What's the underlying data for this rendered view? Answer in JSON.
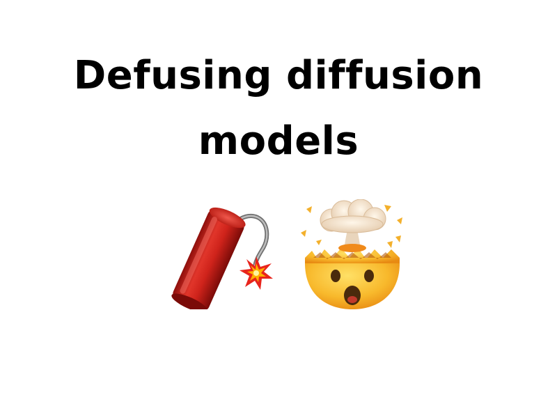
{
  "slide": {
    "title_lines": [
      "Defusing diffusion",
      "models"
    ]
  },
  "icons": [
    "dynamite-icon",
    "exploding-head-icon"
  ],
  "colors": {
    "background": "#ffffff",
    "title": "#000000",
    "dynamite_red": "#d8261e",
    "face_yellow": "#f7b52a"
  }
}
